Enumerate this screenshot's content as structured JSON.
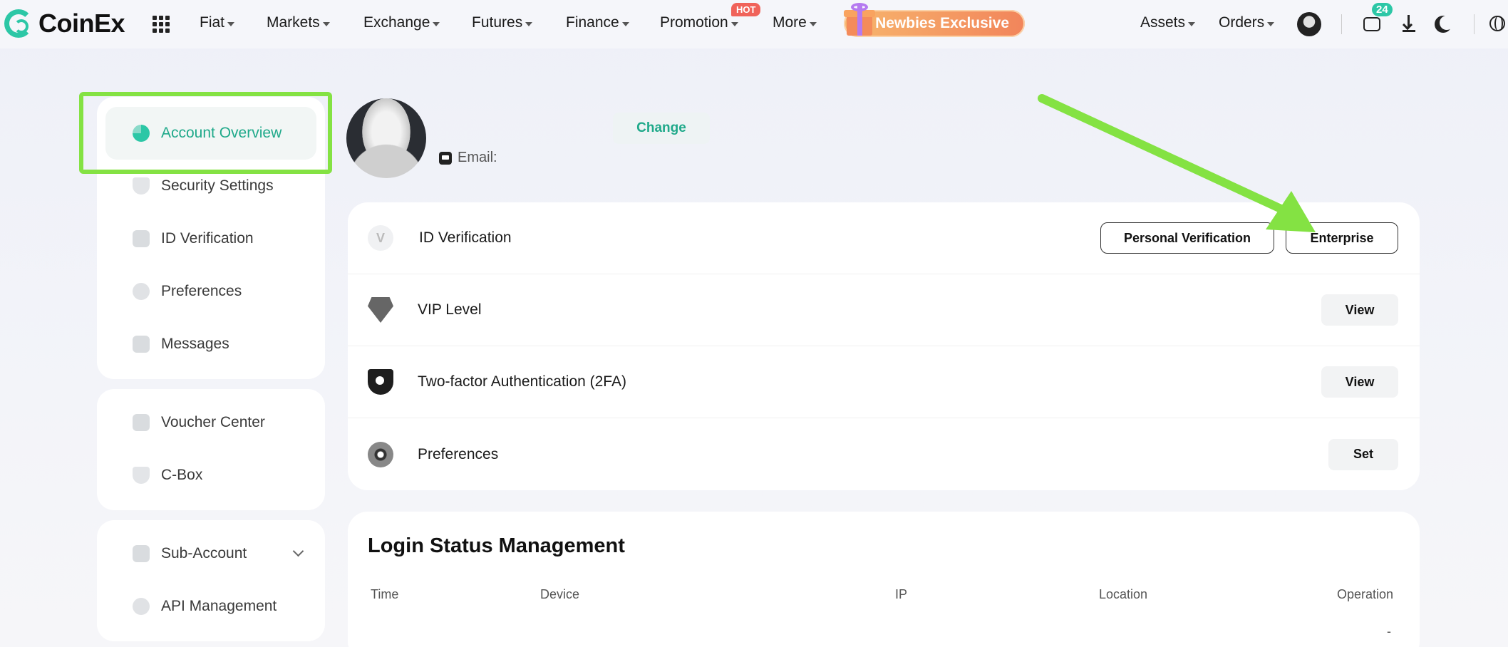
{
  "brand": {
    "name": "CoinEx",
    "accent": "#2cc7a6"
  },
  "nav": {
    "items": [
      {
        "label": "Fiat"
      },
      {
        "label": "Markets"
      },
      {
        "label": "Exchange"
      },
      {
        "label": "Futures"
      },
      {
        "label": "Finance"
      },
      {
        "label": "Promotion",
        "badge": "HOT"
      },
      {
        "label": "More"
      }
    ],
    "promo_label": "Newbies Exclusive",
    "right": {
      "assets": "Assets",
      "orders": "Orders",
      "message_count": "24"
    }
  },
  "sidebar": {
    "groups": [
      {
        "items": [
          {
            "label": "Account Overview",
            "icon": "pie-chart-icon",
            "active": true
          },
          {
            "label": "Security Settings",
            "icon": "shield-icon"
          },
          {
            "label": "ID Verification",
            "icon": "id-icon"
          },
          {
            "label": "Preferences",
            "icon": "preferences-icon"
          },
          {
            "label": "Messages",
            "icon": "messages-icon"
          }
        ]
      },
      {
        "items": [
          {
            "label": "Voucher Center",
            "icon": "voucher-icon"
          },
          {
            "label": "C-Box",
            "icon": "cbox-icon"
          }
        ]
      },
      {
        "items": [
          {
            "label": "Sub-Account",
            "icon": "sub-account-icon"
          },
          {
            "label": "API Management",
            "icon": "api-icon"
          }
        ]
      }
    ]
  },
  "profile": {
    "email_label": "Email:",
    "change_label": "Change"
  },
  "settings": {
    "rows": [
      {
        "label": "ID Verification",
        "buttons": [
          "Personal Verification",
          "Enterprise"
        ]
      },
      {
        "label": "VIP Level",
        "button": "View"
      },
      {
        "label": "Two-factor Authentication (2FA)",
        "button": "View"
      },
      {
        "label": "Preferences",
        "button": "Set"
      }
    ]
  },
  "login_status": {
    "title": "Login Status Management",
    "columns": [
      "Time",
      "Device",
      "IP",
      "Location",
      "Operation"
    ],
    "first_row_operation": "-"
  },
  "annotation": {
    "highlight_color": "#84e243"
  }
}
